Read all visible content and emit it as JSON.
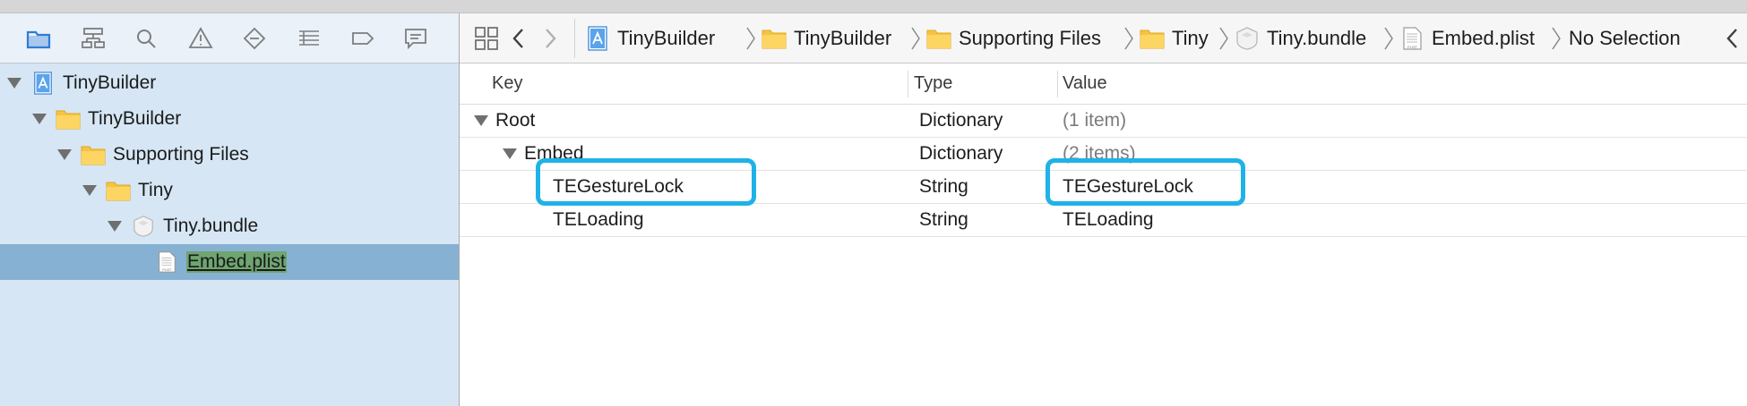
{
  "sidebar": {
    "toolbar_icons": [
      "folder-icon",
      "hierarchy-icon",
      "search-icon",
      "warning-icon",
      "diamond-icon",
      "list-icon",
      "tag-icon",
      "comment-icon"
    ],
    "items": [
      {
        "label": "TinyBuilder",
        "icon": "xcode-project-icon"
      },
      {
        "label": "TinyBuilder",
        "icon": "folder-icon"
      },
      {
        "label": "Supporting Files",
        "icon": "folder-icon"
      },
      {
        "label": "Tiny",
        "icon": "folder-icon"
      },
      {
        "label": "Tiny.bundle",
        "icon": "bundle-icon"
      },
      {
        "label": "Embed.plist",
        "icon": "plist-file-icon",
        "selected": true
      }
    ]
  },
  "jumpbar": {
    "crumbs": [
      {
        "label": "TinyBuilder",
        "icon": "xcode-project-icon"
      },
      {
        "label": "TinyBuilder",
        "icon": "folder-icon"
      },
      {
        "label": "Supporting Files",
        "icon": "folder-icon"
      },
      {
        "label": "Tiny",
        "icon": "folder-icon"
      },
      {
        "label": "Tiny.bundle",
        "icon": "bundle-icon"
      },
      {
        "label": "Embed.plist",
        "icon": "plist-file-icon"
      },
      {
        "label": "No Selection"
      }
    ]
  },
  "plist": {
    "headers": {
      "key": "Key",
      "type": "Type",
      "value": "Value"
    },
    "rows": [
      {
        "key": "Root",
        "type": "Dictionary",
        "value": "(1 item)"
      },
      {
        "key": "Embed",
        "type": "Dictionary",
        "value": "(2 items)"
      },
      {
        "key": "TEGestureLock",
        "type": "String",
        "value": "TEGestureLock"
      },
      {
        "key": "TELoading",
        "type": "String",
        "value": "TELoading"
      }
    ]
  },
  "colors": {
    "sidebar_bg": "#d6e6f4",
    "selection": "#87b1d2",
    "callout": "#1fb2e6",
    "accent": "#2f7bd8"
  }
}
